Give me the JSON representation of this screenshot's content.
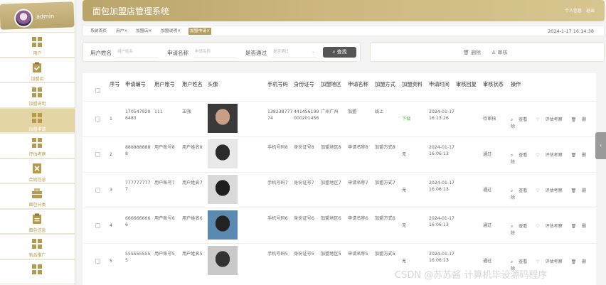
{
  "user": {
    "name": "admin"
  },
  "header": {
    "title": "面包加盟店管理系统",
    "links": [
      "个人信息",
      "退出"
    ]
  },
  "tags": [
    "系统首页",
    "用户×",
    "加盟店×",
    "加盟说明×",
    "加盟申请×"
  ],
  "datetime": "2024-1-17 16:14:38",
  "sidebar": {
    "items": [
      {
        "label": "用户",
        "icon": "grid-icon"
      },
      {
        "label": "加盟店",
        "icon": "clipboard-check-icon"
      },
      {
        "label": "加盟说明",
        "icon": "grid-icon"
      },
      {
        "label": "加盟申请",
        "icon": "grid-icon",
        "active": true
      },
      {
        "label": "评估考察",
        "icon": "grid-icon"
      },
      {
        "label": "合同信息",
        "icon": "document-x-icon"
      },
      {
        "label": "面包分类",
        "icon": "briefcase-icon"
      },
      {
        "label": "面包信息",
        "icon": "clipboard-icon"
      },
      {
        "label": "新品推广",
        "icon": "grid-icon"
      },
      {
        "label": "",
        "icon": "grid-icon"
      }
    ]
  },
  "search": {
    "user_name_label": "用户姓名",
    "user_name_placeholder": "用户姓名",
    "apply_name_label": "申请名称",
    "apply_name_placeholder": "申请名称",
    "approved_label": "是否通过",
    "approved_placeholder": "是否通过",
    "search_button": "查找"
  },
  "actions": {
    "delete": "删除",
    "review": "审核"
  },
  "table": {
    "headers": [
      "序号",
      "申请编号",
      "用户账号",
      "用户姓名",
      "头像",
      "手机号码",
      "身份证号",
      "加盟地区",
      "申请名称",
      "加盟方式",
      "加盟资料",
      "申请时间",
      "审核回复",
      "审核状态",
      "操作"
    ],
    "ops": [
      "查看",
      "评估考察",
      "删除"
    ],
    "rows": [
      {
        "no": "1",
        "apply_id": "1705479206483",
        "account": "111",
        "name": "王强",
        "phone": "13823877774",
        "idcard": "441456199000201456",
        "region": "广州广州",
        "apply_name": "加盟",
        "method": "线上",
        "material": "下载",
        "time": "2024-01-17 16:13:26",
        "reply": "",
        "status": "待审核"
      },
      {
        "no": "2",
        "apply_id": "8888888888",
        "account": "用户账号8",
        "name": "用户姓名8",
        "phone": "手机号码8",
        "idcard": "身份证号8",
        "region": "加盟地区8",
        "apply_name": "申请名称8",
        "method": "加盟方式8",
        "material": "无",
        "time": "2024-01-17 16:06:13",
        "reply": "",
        "status": "通过"
      },
      {
        "no": "3",
        "apply_id": "7777777777",
        "account": "用户账号7",
        "name": "用户姓名7",
        "phone": "手机号码7",
        "idcard": "身份证号7",
        "region": "加盟地区7",
        "apply_name": "申请名称7",
        "method": "加盟方式7",
        "material": "无",
        "time": "2024-01-17 16:06:13",
        "reply": "",
        "status": "通过"
      },
      {
        "no": "4",
        "apply_id": "6666666666",
        "account": "用户账号6",
        "name": "用户姓名6",
        "phone": "手机号码6",
        "idcard": "身份证号6",
        "region": "加盟地区6",
        "apply_name": "申请名称6",
        "method": "加盟方式6",
        "material": "无",
        "time": "2024-01-17 16:06:13",
        "reply": "",
        "status": "通过"
      },
      {
        "no": "5",
        "apply_id": "5555555555",
        "account": "用户账号5",
        "name": "用户姓名5",
        "phone": "手机号码5",
        "idcard": "身份证号5",
        "region": "加盟地区5",
        "apply_name": "申请名称5",
        "method": "加盟方式5",
        "material": "无",
        "time": "2024-01-17 16:06:13",
        "reply": "",
        "status": "通过"
      }
    ]
  },
  "watermark": "CSDN @苏苏酱 计算机毕设源码程序",
  "colors": {
    "accent": "#b59f5f",
    "sidebar_active": "#e3d5a4",
    "sidebar_label": "#b79a4d"
  }
}
